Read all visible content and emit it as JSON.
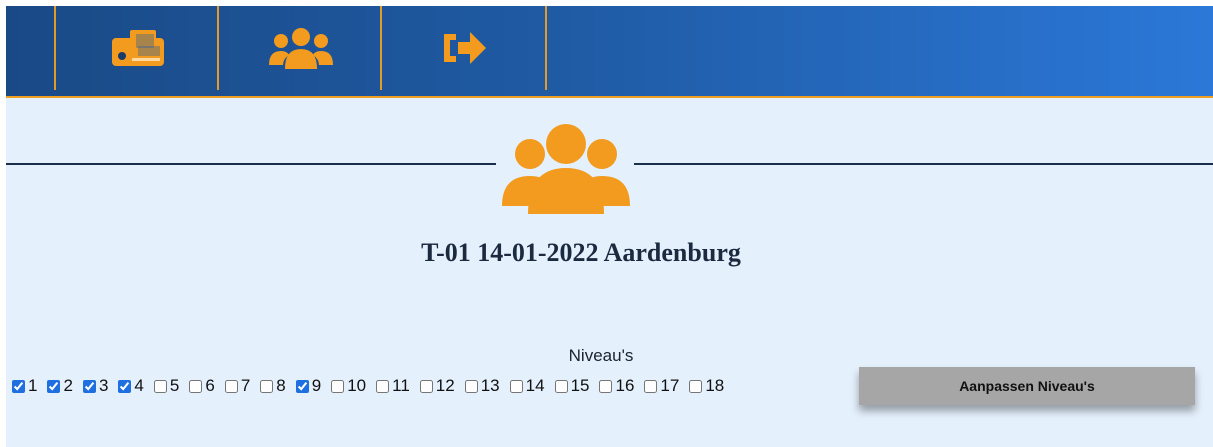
{
  "nav": {
    "items": [
      {
        "icon": "id-card-icon"
      },
      {
        "icon": "users-icon"
      },
      {
        "icon": "sign-out-icon"
      }
    ],
    "accent_color": "#f0a020",
    "gradient": [
      "#1a4a86",
      "#2b78d8"
    ]
  },
  "header": {
    "icon": "users-icon",
    "title": "T-01 14-01-2022 Aardenburg"
  },
  "levels": {
    "label": "Niveau's",
    "items": [
      {
        "label": "1",
        "checked": true
      },
      {
        "label": "2",
        "checked": true
      },
      {
        "label": "3",
        "checked": true
      },
      {
        "label": "4",
        "checked": true
      },
      {
        "label": "5",
        "checked": false
      },
      {
        "label": "6",
        "checked": false
      },
      {
        "label": "7",
        "checked": false
      },
      {
        "label": "8",
        "checked": false
      },
      {
        "label": "9",
        "checked": true
      },
      {
        "label": "10",
        "checked": false
      },
      {
        "label": "11",
        "checked": false
      },
      {
        "label": "12",
        "checked": false
      },
      {
        "label": "13",
        "checked": false
      },
      {
        "label": "14",
        "checked": false
      },
      {
        "label": "15",
        "checked": false
      },
      {
        "label": "16",
        "checked": false
      },
      {
        "label": "17",
        "checked": false
      },
      {
        "label": "18",
        "checked": false
      }
    ],
    "button_label": "Aanpassen Niveau's"
  }
}
